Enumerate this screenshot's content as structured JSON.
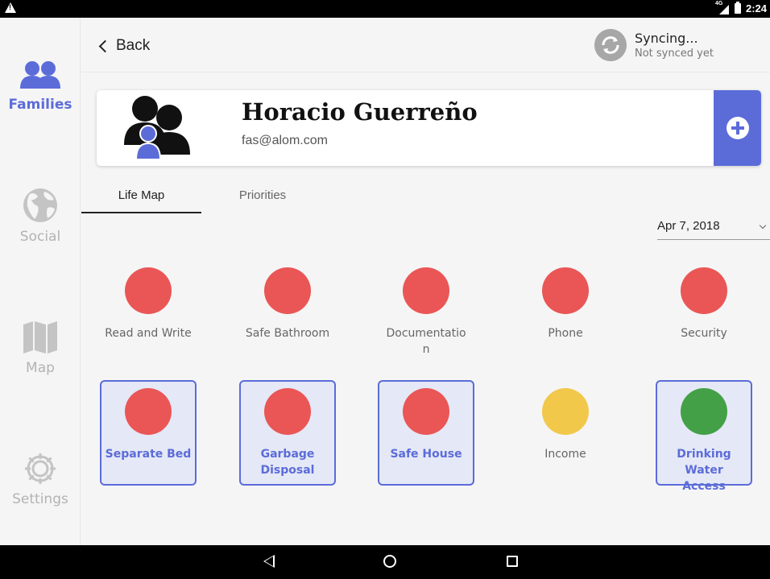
{
  "status_bar": {
    "network": "4G",
    "time": "2:24"
  },
  "sidebar": {
    "items": [
      {
        "label": "Families",
        "icon": "families-icon",
        "active": true
      },
      {
        "label": "Social",
        "icon": "globe-icon",
        "active": false
      },
      {
        "label": "Map",
        "icon": "map-icon",
        "active": false
      },
      {
        "label": "Settings",
        "icon": "gear-icon",
        "active": false
      }
    ]
  },
  "header": {
    "back_label": "Back",
    "sync_title": "Syncing...",
    "sync_subtitle": "Not synced yet"
  },
  "family": {
    "name": "Horacio Guerreño",
    "email": "fas@alom.com"
  },
  "tabs": [
    {
      "label": "Life Map",
      "active": true
    },
    {
      "label": "Priorities",
      "active": false
    }
  ],
  "date_select": {
    "value": "Apr 7, 2018"
  },
  "indicators": [
    {
      "label": "Read and Write",
      "color": "#ea5656",
      "selected": false
    },
    {
      "label": "Safe Bathroom",
      "color": "#ea5656",
      "selected": false
    },
    {
      "label": "Documentatio\nn",
      "color": "#ea5656",
      "selected": false
    },
    {
      "label": "Phone",
      "color": "#ea5656",
      "selected": false
    },
    {
      "label": "Security",
      "color": "#ea5656",
      "selected": false
    },
    {
      "label": "Separate Bed",
      "color": "#ea5656",
      "selected": true
    },
    {
      "label": "Garbage\nDisposal",
      "color": "#ea5656",
      "selected": true
    },
    {
      "label": "Safe House",
      "color": "#ea5656",
      "selected": true
    },
    {
      "label": "Income",
      "color": "#f2c84b",
      "selected": false
    },
    {
      "label": "Drinking Water\nAccess",
      "color": "#43a047",
      "selected": true
    }
  ],
  "colors": {
    "accent": "#5b6cd9",
    "red": "#ea5656",
    "yellow": "#f2c84b",
    "green": "#43a047"
  }
}
